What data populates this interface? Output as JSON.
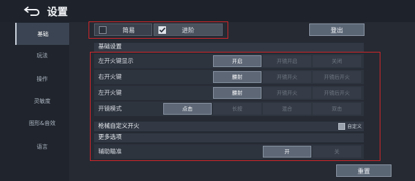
{
  "header": {
    "title": "设置"
  },
  "sidebar": {
    "items": [
      {
        "label": "基础"
      },
      {
        "label": "玩法"
      },
      {
        "label": "操作"
      },
      {
        "label": "灵敏度"
      },
      {
        "label": "图形&音效"
      },
      {
        "label": "语言"
      }
    ]
  },
  "mode_toggle": {
    "simple_label": "简易",
    "advanced_label": "进阶",
    "selected": "进阶"
  },
  "logout_label": "登出",
  "basic_settings": {
    "title": "基础设置",
    "rows": [
      {
        "label": "左开火键显示",
        "options": [
          "开启",
          "开镜开启",
          "关闭"
        ],
        "selected": "开启"
      },
      {
        "label": "右开火键",
        "options": [
          "腰射",
          "开镜开火",
          "开镜后开火"
        ],
        "selected": "腰射"
      },
      {
        "label": "左开火键",
        "options": [
          "腰射",
          "开镜开火",
          "开镜后开火"
        ],
        "selected": "腰射"
      },
      {
        "label": "开镜模式",
        "options": [
          "点击",
          "长按",
          "混合",
          "双击"
        ],
        "selected": "点击"
      }
    ]
  },
  "gun_custom_fire": {
    "label": "枪械自定义开火",
    "checkbox_label": "自定义"
  },
  "more_options": {
    "title": "更多选项",
    "aim_assist": {
      "label": "辅助瞄准",
      "options": [
        "开",
        "关"
      ],
      "selected": "开"
    }
  },
  "reset_label": "重置",
  "colors": {
    "highlight_box": "#d7262a",
    "panel": "#2e343e",
    "selected_option": "#5d6776"
  }
}
